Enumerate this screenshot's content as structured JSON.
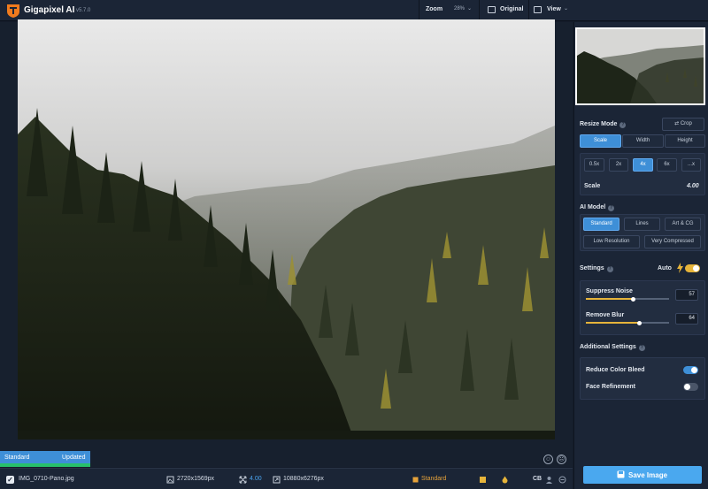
{
  "app": {
    "title": "Gigapixel AI",
    "version": "v5.7.0"
  },
  "toolbar": {
    "zoom_label": "Zoom",
    "zoom_value": "28%",
    "original_label": "Original",
    "view_label": "View"
  },
  "preview": {
    "image_desc_icon": "forest-mist-photo"
  },
  "status": {
    "model_name": "Standard",
    "model_state": "Updated",
    "progress": 1.0
  },
  "filebar": {
    "file_name": "IMG_0710-Pano.jpg",
    "source_dims": "2720x1569px",
    "scale": "4.00",
    "output_dims": "10880x6276px",
    "model": "Standard",
    "cb_label": "CB"
  },
  "panel": {
    "resize_mode": {
      "title": "Resize Mode",
      "crop_label": "Crop",
      "tabs": [
        "Scale",
        "Width",
        "Height"
      ],
      "active_tab": "Scale",
      "scale_options": [
        "0.5x",
        "2x",
        "4x",
        "6x",
        "...x"
      ],
      "active_scale": "4x",
      "scale_label": "Scale",
      "scale_value": "4.00"
    },
    "ai_model": {
      "title": "AI Model",
      "options": [
        "Standard",
        "Lines",
        "Art & CG",
        "Low Resolution",
        "Very Compressed"
      ],
      "active": "Standard"
    },
    "settings": {
      "title": "Settings",
      "auto_label": "Auto",
      "auto_on": true,
      "suppress_noise_label": "Suppress Noise",
      "suppress_noise_value": "57",
      "remove_blur_label": "Remove Blur",
      "remove_blur_value": "64"
    },
    "additional": {
      "title": "Additional Settings",
      "reduce_color_bleed_label": "Reduce Color Bleed",
      "reduce_color_bleed_on": true,
      "face_refinement_label": "Face Refinement",
      "face_refinement_on": false
    },
    "save_label": "Save Image"
  },
  "colors": {
    "accent": "#3e8fd7",
    "highlight": "#e6b43a",
    "success": "#27c06b",
    "background": "#141c2a"
  }
}
